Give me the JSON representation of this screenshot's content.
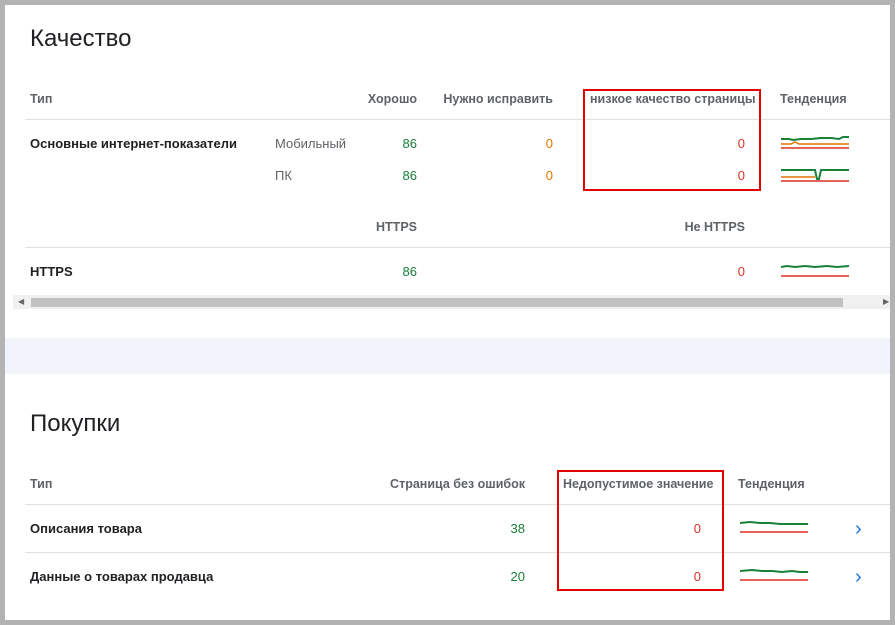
{
  "quality": {
    "title": "Качество",
    "headers": {
      "type": "Тип",
      "good": "Хорошо",
      "needs_fix": "Нужно исправить",
      "poor": "низкое качество страницы",
      "trend": "Тенденция"
    },
    "cwv": {
      "label": "Основные интернет-показатели",
      "mobile": {
        "device": "Мобильный",
        "good": "86",
        "needs_fix": "0",
        "poor": "0"
      },
      "desktop": {
        "device": "ПК",
        "good": "86",
        "needs_fix": "0",
        "poor": "0"
      }
    },
    "https_headers": {
      "https": "HTTPS",
      "not_https": "Не HTTPS"
    },
    "https_row": {
      "label": "HTTPS",
      "https": "86",
      "not_https": "0"
    }
  },
  "shopping": {
    "title": "Покупки",
    "headers": {
      "type": "Тип",
      "valid": "Страница без ошибок",
      "invalid": "Недопустимое значение",
      "trend": "Тенденция"
    },
    "rows": [
      {
        "label": "Описания товара",
        "valid": "38",
        "invalid": "0"
      },
      {
        "label": "Данные о товарах продавца",
        "valid": "20",
        "invalid": "0"
      }
    ]
  },
  "colors": {
    "good": "#188038",
    "warn": "#e37400",
    "bad": "#d93025",
    "highlight": "#e50000",
    "link": "#1a73e8"
  },
  "icons": {
    "row_open": "chevron-right-icon",
    "scroll_left": "scroll-left-arrow-icon",
    "scroll_right": "scroll-right-arrow-icon"
  }
}
